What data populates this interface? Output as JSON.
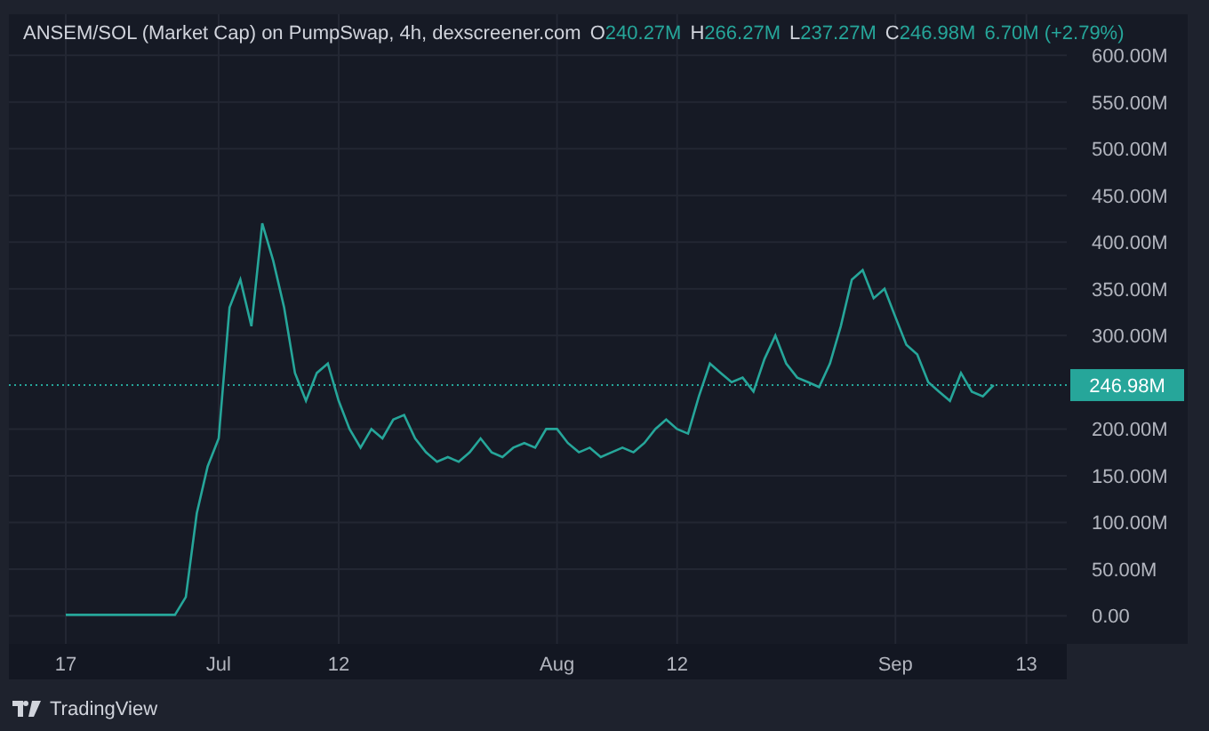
{
  "chart": {
    "title": "ANSEM/SOL (Market Cap) on PumpSwap, 4h, dexscreener.com",
    "ohlc": [
      {
        "label": "O",
        "value": "240.27M"
      },
      {
        "label": "H",
        "value": "266.27M"
      },
      {
        "label": "L",
        "value": "237.27M"
      },
      {
        "label": "C",
        "value": "246.98M"
      }
    ],
    "change": "6.70M (+2.79%)",
    "last_price_label": "246.98M",
    "chart_data": {
      "type": "line",
      "categories": [
        "17",
        null,
        null,
        null,
        null,
        null,
        null,
        null,
        null,
        null,
        null,
        null,
        null,
        null,
        "Jul",
        null,
        null,
        null,
        null,
        null,
        null,
        null,
        null,
        null,
        null,
        "12",
        null,
        null,
        null,
        null,
        null,
        null,
        null,
        null,
        null,
        null,
        null,
        null,
        null,
        null,
        null,
        null,
        null,
        null,
        null,
        "Aug",
        null,
        null,
        null,
        null,
        null,
        null,
        null,
        null,
        null,
        null,
        "12",
        null,
        null,
        null,
        null,
        null,
        null,
        null,
        null,
        null,
        null,
        null,
        null,
        null,
        null,
        null,
        null,
        null,
        null,
        null,
        "Sep",
        null,
        null,
        null,
        null,
        null,
        null,
        null,
        null,
        null,
        null,
        null,
        "13",
        null,
        null,
        null
      ],
      "series": [
        {
          "color": "#26a69a",
          "values": [
            1,
            1,
            1,
            1,
            1,
            1,
            1,
            1,
            1,
            1,
            1,
            20,
            110,
            160,
            190,
            330,
            360,
            310,
            420,
            380,
            330,
            260,
            230,
            260,
            270,
            230,
            200,
            180,
            200,
            190,
            210,
            215,
            190,
            175,
            165,
            170,
            165,
            175,
            190,
            175,
            170,
            180,
            185,
            180,
            200,
            200,
            185,
            175,
            180,
            170,
            175,
            180,
            175,
            185,
            200,
            210,
            200,
            195,
            235,
            270,
            260,
            250,
            255,
            240,
            275,
            300,
            270,
            255,
            250,
            245,
            270,
            310,
            360,
            370,
            340,
            350,
            320,
            290,
            280,
            250,
            240,
            230,
            260,
            240,
            235,
            247,
            null,
            null,
            null,
            null,
            null,
            null
          ]
        }
      ],
      "ylim": [
        -30,
        644
      ],
      "grid": true,
      "ref_lines": [
        {
          "axis": "y",
          "value": 246.98
        }
      ],
      "yticks": [
        {
          "value": 0,
          "label": "0.00"
        },
        {
          "value": 50,
          "label": "50.00M"
        },
        {
          "value": 100,
          "label": "100.00M"
        },
        {
          "value": 150,
          "label": "150.00M"
        },
        {
          "value": 200,
          "label": "200.00M"
        },
        {
          "value": 300,
          "label": "300.00M"
        },
        {
          "value": 350,
          "label": "350.00M"
        },
        {
          "value": 400,
          "label": "400.00M"
        },
        {
          "value": 450,
          "label": "450.00M"
        },
        {
          "value": 500,
          "label": "500.00M"
        },
        {
          "value": 550,
          "label": "550.00M"
        },
        {
          "value": 600,
          "label": "600.00M"
        }
      ]
    }
  },
  "branding": "TradingView"
}
